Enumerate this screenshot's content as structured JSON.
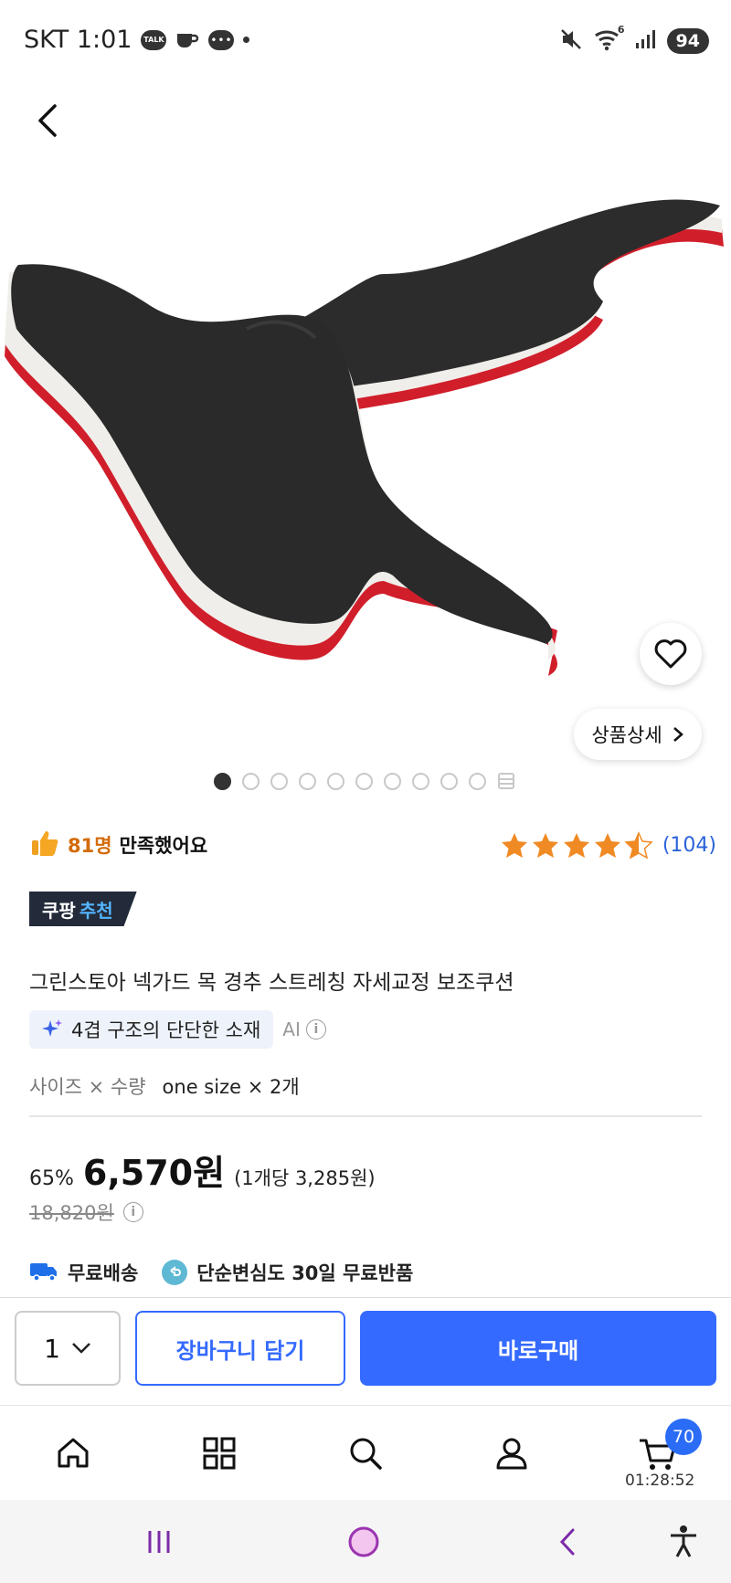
{
  "status_bar": {
    "carrier_time": "SKT 1:01",
    "talk_icon_text": "TALK",
    "battery": "94",
    "wifi_badge": "6"
  },
  "hero": {
    "pager_total": 10,
    "pager_active": 0,
    "detail_label": "상품상세",
    "colors": {
      "black": "#2a2a2a",
      "red": "#d01f2b",
      "white": "#f0eeea"
    }
  },
  "rating": {
    "satisfied_count": "81명",
    "satisfied_text": "만족했어요",
    "stars": 4.5,
    "review_count": "(104)"
  },
  "badge": {
    "label_main": "쿠팡",
    "label_accent": "추천"
  },
  "product": {
    "title": "그린스토아 넥가드 목 경추 스트레칭 자세교정 보조쿠션",
    "ai_summary": "4겹 구조의 단단한 소재",
    "ai_label": "AI",
    "option_label": "사이즈 × 수량",
    "option_value": "one size × 2개"
  },
  "price": {
    "discount": "65%",
    "sale_price": "6,570원",
    "unit_price": "(1개당 3,285원)",
    "original_price": "18,820원"
  },
  "shipping": {
    "free_shipping": "무료배송",
    "free_return": "단순변심도 30일 무료반품"
  },
  "actions": {
    "quantity": "1",
    "add_to_cart": "장바구니 담기",
    "buy_now": "바로구매",
    "accent_color": "#346aff"
  },
  "bottom_nav": {
    "cart_count": "70",
    "cart_timer": "01:28:52"
  }
}
